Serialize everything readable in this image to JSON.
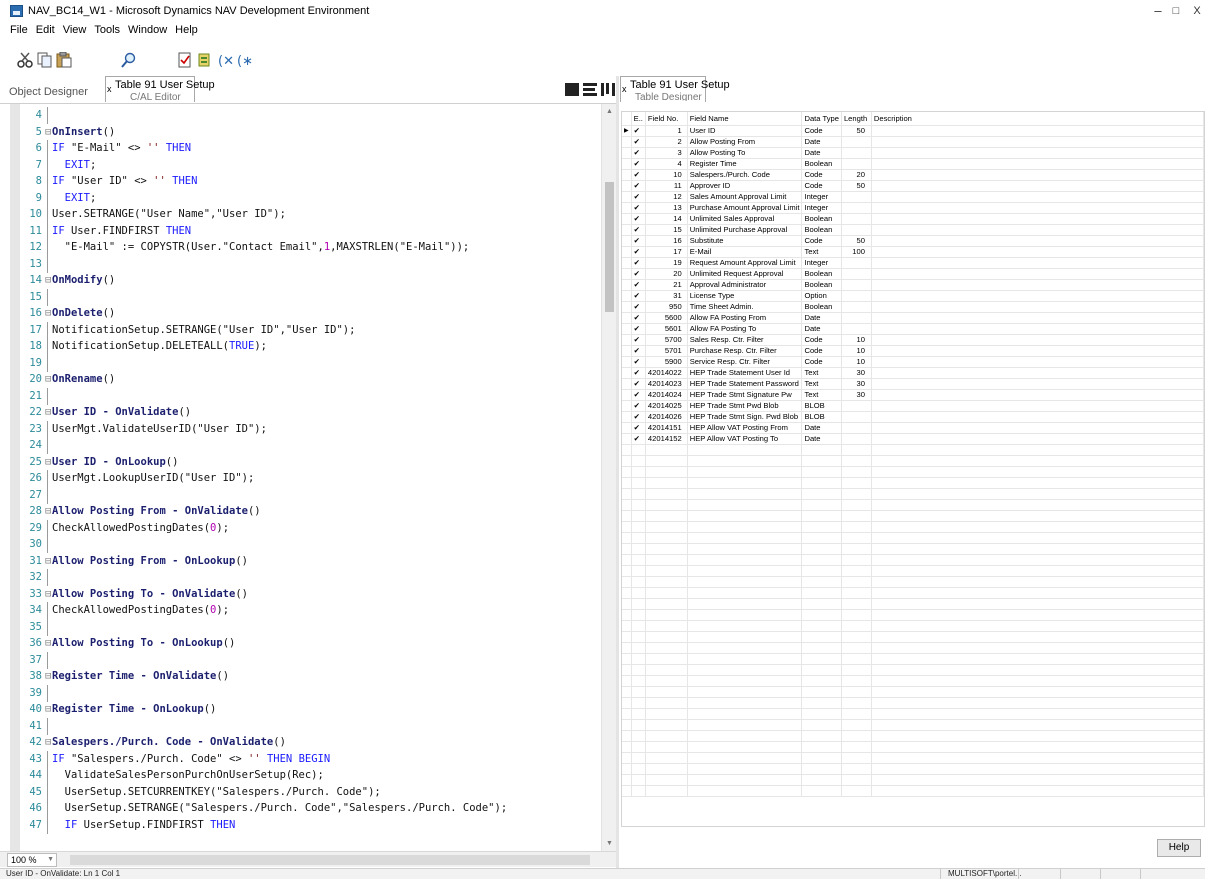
{
  "window": {
    "title": "NAV_BC14_W1 - Microsoft Dynamics NAV Development Environment",
    "controls": {
      "minimize": "–",
      "restore": "□",
      "close": "X"
    }
  },
  "menu": [
    "File",
    "Edit",
    "View",
    "Tools",
    "Window",
    "Help"
  ],
  "toolbar": {
    "icons": [
      "cut-icon",
      "copy-icon",
      "paste-icon",
      "find-icon",
      "compile-icon",
      "design-icon",
      "symbol-menu-icon",
      "help-icon"
    ]
  },
  "tabs": {
    "object_designer": "Object Designer",
    "left_tab_title": "Table 91 User Setup",
    "left_tab_sub": "C/AL Editor",
    "right_tab_title": "Table 91 User Setup",
    "right_tab_sub": "Table Designer",
    "close_glyph": "x"
  },
  "code_lines": [
    {
      "n": "4",
      "fold": "",
      "text": ""
    },
    {
      "n": "5",
      "fold": "⊟",
      "trigger": "OnInsert",
      "args": "()"
    },
    {
      "n": "6",
      "fold": "",
      "text": "IF \"E-Mail\" <> '' THEN"
    },
    {
      "n": "7",
      "fold": "",
      "text": "  EXIT;"
    },
    {
      "n": "8",
      "fold": "",
      "text": "IF \"User ID\" <> '' THEN"
    },
    {
      "n": "9",
      "fold": "",
      "text": "  EXIT;"
    },
    {
      "n": "10",
      "fold": "",
      "text": "User.SETRANGE(\"User Name\",\"User ID\");"
    },
    {
      "n": "11",
      "fold": "",
      "text": "IF User.FINDFIRST THEN"
    },
    {
      "n": "12",
      "fold": "",
      "text": "  \"E-Mail\" := COPYSTR(User.\"Contact Email\",1,MAXSTRLEN(\"E-Mail\"));"
    },
    {
      "n": "13",
      "fold": "",
      "text": ""
    },
    {
      "n": "14",
      "fold": "⊟",
      "trigger": "OnModify",
      "args": "()"
    },
    {
      "n": "15",
      "fold": "",
      "text": ""
    },
    {
      "n": "16",
      "fold": "⊟",
      "trigger": "OnDelete",
      "args": "()"
    },
    {
      "n": "17",
      "fold": "",
      "text": "NotificationSetup.SETRANGE(\"User ID\",\"User ID\");"
    },
    {
      "n": "18",
      "fold": "",
      "text": "NotificationSetup.DELETEALL(TRUE);"
    },
    {
      "n": "19",
      "fold": "",
      "text": ""
    },
    {
      "n": "20",
      "fold": "⊟",
      "trigger": "OnRename",
      "args": "()"
    },
    {
      "n": "21",
      "fold": "",
      "text": ""
    },
    {
      "n": "22",
      "fold": "⊟",
      "trigger": "User ID - OnValidate",
      "args": "()"
    },
    {
      "n": "23",
      "fold": "",
      "text": "UserMgt.ValidateUserID(\"User ID\");"
    },
    {
      "n": "24",
      "fold": "",
      "text": ""
    },
    {
      "n": "25",
      "fold": "⊟",
      "trigger": "User ID - OnLookup",
      "args": "()"
    },
    {
      "n": "26",
      "fold": "",
      "text": "UserMgt.LookupUserID(\"User ID\");"
    },
    {
      "n": "27",
      "fold": "",
      "text": ""
    },
    {
      "n": "28",
      "fold": "⊟",
      "trigger": "Allow Posting From - OnValidate",
      "args": "()"
    },
    {
      "n": "29",
      "fold": "",
      "text": "CheckAllowedPostingDates(0);"
    },
    {
      "n": "30",
      "fold": "",
      "text": ""
    },
    {
      "n": "31",
      "fold": "⊟",
      "trigger": "Allow Posting From - OnLookup",
      "args": "()"
    },
    {
      "n": "32",
      "fold": "",
      "text": ""
    },
    {
      "n": "33",
      "fold": "⊟",
      "trigger": "Allow Posting To - OnValidate",
      "args": "()"
    },
    {
      "n": "34",
      "fold": "",
      "text": "CheckAllowedPostingDates(0);"
    },
    {
      "n": "35",
      "fold": "",
      "text": ""
    },
    {
      "n": "36",
      "fold": "⊟",
      "trigger": "Allow Posting To - OnLookup",
      "args": "()"
    },
    {
      "n": "37",
      "fold": "",
      "text": ""
    },
    {
      "n": "38",
      "fold": "⊟",
      "trigger": "Register Time - OnValidate",
      "args": "()"
    },
    {
      "n": "39",
      "fold": "",
      "text": ""
    },
    {
      "n": "40",
      "fold": "⊟",
      "trigger": "Register Time - OnLookup",
      "args": "()"
    },
    {
      "n": "41",
      "fold": "",
      "text": ""
    },
    {
      "n": "42",
      "fold": "⊟",
      "trigger": "Salespers./Purch. Code - OnValidate",
      "args": "()"
    },
    {
      "n": "43",
      "fold": "",
      "text": "IF \"Salespers./Purch. Code\" <> '' THEN BEGIN"
    },
    {
      "n": "44",
      "fold": "",
      "text": "  ValidateSalesPersonPurchOnUserSetup(Rec);"
    },
    {
      "n": "45",
      "fold": "",
      "text": "  UserSetup.SETCURRENTKEY(\"Salespers./Purch. Code\");"
    },
    {
      "n": "46",
      "fold": "",
      "text": "  UserSetup.SETRANGE(\"Salespers./Purch. Code\",\"Salespers./Purch. Code\");"
    },
    {
      "n": "47",
      "fold": "",
      "text": "  IF UserSetup.FINDFIRST THEN"
    }
  ],
  "editor": {
    "zoom": "100 %"
  },
  "table_designer": {
    "columns": [
      "E..",
      "Field No.",
      "Field Name",
      "Data Type",
      "Length",
      "Description"
    ],
    "rows": [
      {
        "enabled": "✔",
        "no": "1",
        "name": "User ID",
        "type": "Code",
        "length": "50"
      },
      {
        "enabled": "✔",
        "no": "2",
        "name": "Allow Posting From",
        "type": "Date",
        "length": ""
      },
      {
        "enabled": "✔",
        "no": "3",
        "name": "Allow Posting To",
        "type": "Date",
        "length": ""
      },
      {
        "enabled": "✔",
        "no": "4",
        "name": "Register Time",
        "type": "Boolean",
        "length": ""
      },
      {
        "enabled": "✔",
        "no": "10",
        "name": "Salespers./Purch. Code",
        "type": "Code",
        "length": "20"
      },
      {
        "enabled": "✔",
        "no": "11",
        "name": "Approver ID",
        "type": "Code",
        "length": "50"
      },
      {
        "enabled": "✔",
        "no": "12",
        "name": "Sales Amount Approval Limit",
        "type": "Integer",
        "length": ""
      },
      {
        "enabled": "✔",
        "no": "13",
        "name": "Purchase Amount Approval Limit",
        "type": "Integer",
        "length": ""
      },
      {
        "enabled": "✔",
        "no": "14",
        "name": "Unlimited Sales Approval",
        "type": "Boolean",
        "length": ""
      },
      {
        "enabled": "✔",
        "no": "15",
        "name": "Unlimited Purchase Approval",
        "type": "Boolean",
        "length": ""
      },
      {
        "enabled": "✔",
        "no": "16",
        "name": "Substitute",
        "type": "Code",
        "length": "50"
      },
      {
        "enabled": "✔",
        "no": "17",
        "name": "E-Mail",
        "type": "Text",
        "length": "100"
      },
      {
        "enabled": "✔",
        "no": "19",
        "name": "Request Amount Approval Limit",
        "type": "Integer",
        "length": ""
      },
      {
        "enabled": "✔",
        "no": "20",
        "name": "Unlimited Request Approval",
        "type": "Boolean",
        "length": ""
      },
      {
        "enabled": "✔",
        "no": "21",
        "name": "Approval Administrator",
        "type": "Boolean",
        "length": ""
      },
      {
        "enabled": "✔",
        "no": "31",
        "name": "License Type",
        "type": "Option",
        "length": ""
      },
      {
        "enabled": "✔",
        "no": "950",
        "name": "Time Sheet Admin.",
        "type": "Boolean",
        "length": ""
      },
      {
        "enabled": "✔",
        "no": "5600",
        "name": "Allow FA Posting From",
        "type": "Date",
        "length": ""
      },
      {
        "enabled": "✔",
        "no": "5601",
        "name": "Allow FA Posting To",
        "type": "Date",
        "length": ""
      },
      {
        "enabled": "✔",
        "no": "5700",
        "name": "Sales Resp. Ctr. Filter",
        "type": "Code",
        "length": "10"
      },
      {
        "enabled": "✔",
        "no": "5701",
        "name": "Purchase Resp. Ctr. Filter",
        "type": "Code",
        "length": "10"
      },
      {
        "enabled": "✔",
        "no": "5900",
        "name": "Service Resp. Ctr. Filter",
        "type": "Code",
        "length": "10"
      },
      {
        "enabled": "✔",
        "no": "42014022",
        "name": "HEP Trade Statement User Id",
        "type": "Text",
        "length": "30"
      },
      {
        "enabled": "✔",
        "no": "42014023",
        "name": "HEP Trade Statement Password",
        "type": "Text",
        "length": "30"
      },
      {
        "enabled": "✔",
        "no": "42014024",
        "name": "HEP Trade Stmt Signature Pw",
        "type": "Text",
        "length": "30"
      },
      {
        "enabled": "✔",
        "no": "42014025",
        "name": "HEP Trade Stmt Pwd Blob",
        "type": "BLOB",
        "length": ""
      },
      {
        "enabled": "✔",
        "no": "42014026",
        "name": "HEP Trade Stmt Sign. Pwd Blob",
        "type": "BLOB",
        "length": ""
      },
      {
        "enabled": "✔",
        "no": "42014151",
        "name": "HEP Allow VAT Posting From",
        "type": "Date",
        "length": ""
      },
      {
        "enabled": "✔",
        "no": "42014152",
        "name": "HEP Allow VAT Posting To",
        "type": "Date",
        "length": ""
      }
    ],
    "current_row_marker": "▶",
    "help_button": "Help"
  },
  "status": {
    "left": "User ID - OnValidate: Ln 1 Col 1",
    "right": "MULTISOFT\\portel..."
  }
}
